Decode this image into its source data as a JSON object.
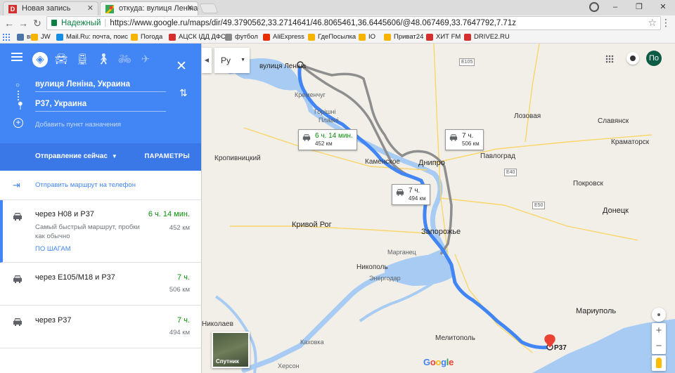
{
  "browser": {
    "tabs": [
      {
        "title": "Новая запись",
        "favicon_color": "#d32f2f",
        "favicon_letter": "D"
      },
      {
        "title": "откуда: вулиця Леніна, У",
        "favicon_color": "#34a853"
      }
    ],
    "window_buttons": [
      "–",
      "❐",
      "✕"
    ],
    "address": {
      "secure_label": "Надежный",
      "url": "https://www.google.ru/maps/dir/49.3790562,33.2714641/46.8065461,36.6445606/@48.067469,33.7647792,7.71z"
    },
    "bookmarks": [
      {
        "label": "вк",
        "color": "#4a76a8"
      },
      {
        "label": "JW",
        "color": "#f4b400"
      },
      {
        "label": "Mail.Ru: почта, поис",
        "color": "#168de2"
      },
      {
        "label": "Погода",
        "color": "#f4b400"
      },
      {
        "label": "АЦСК ІДД ДФС",
        "color": "#d32f2f"
      },
      {
        "label": "футбол",
        "color": "#888888"
      },
      {
        "label": "AliExpress",
        "color": "#e62e04"
      },
      {
        "label": "ГдеПосылка",
        "color": "#f4b400"
      },
      {
        "label": "IO",
        "color": "#f4b400"
      },
      {
        "label": "Приват24",
        "color": "#f4b400"
      },
      {
        "label": "ХИТ FM",
        "color": "#d32f2f"
      },
      {
        "label": "DRIVE2.RU",
        "color": "#d32f2f"
      }
    ]
  },
  "directions": {
    "modes": [
      "menu",
      "best",
      "car",
      "transit",
      "walk",
      "bike",
      "flight"
    ],
    "origin": "вулиця Леніна, Украина",
    "destination": "Р37, Украина",
    "add_destination": "Добавить пункт назначения",
    "depart": "Отправление сейчас",
    "params": "ПАРАМЕТРЫ",
    "send_to_phone": "Отправить маршрут на телефон",
    "routes": [
      {
        "via": "через Н08 и Р37",
        "time": "6 ч. 14 мин.",
        "distance": "452 км",
        "note": "Самый быстрый маршрут, пробки как обычно",
        "steps": "ПО ШАГАМ",
        "selected": true
      },
      {
        "via": "через E105/M18 и Р37",
        "time": "7 ч.",
        "distance": "506 км",
        "selected": false
      },
      {
        "via": "через Р37",
        "time": "7 ч.",
        "distance": "494 км",
        "selected": false
      }
    ]
  },
  "map": {
    "lang": "Ру",
    "avatar": "По",
    "satellite": "Спутник",
    "google": "Google",
    "origin_label": "вулиця Леніна",
    "dest_label": "Р37",
    "callouts": [
      {
        "time": "6 ч. 14 мин.",
        "distance": "452 км",
        "fastest": true
      },
      {
        "time": "7 ч.",
        "distance": "506 км",
        "fastest": false
      },
      {
        "time": "7 ч.",
        "distance": "494 км",
        "fastest": false
      }
    ],
    "places": [
      {
        "name": "Кременчуг",
        "kind": "small"
      },
      {
        "name": "Горішні",
        "kind": "small"
      },
      {
        "name": "Плавні",
        "kind": "small"
      },
      {
        "name": "Каменское",
        "kind": "city"
      },
      {
        "name": "Днипро",
        "kind": "big"
      },
      {
        "name": "Павлоград",
        "kind": "city"
      },
      {
        "name": "Лозовая",
        "kind": "city"
      },
      {
        "name": "Славянск",
        "kind": "city"
      },
      {
        "name": "Краматорск",
        "kind": "city"
      },
      {
        "name": "Покровск",
        "kind": "city"
      },
      {
        "name": "Донецк",
        "kind": "big"
      },
      {
        "name": "Кропивницкий",
        "kind": "city"
      },
      {
        "name": "Кривой Рог",
        "kind": "big"
      },
      {
        "name": "Запорожье",
        "kind": "big"
      },
      {
        "name": "Марганец",
        "kind": "small"
      },
      {
        "name": "Никополь",
        "kind": "city"
      },
      {
        "name": "Энергодар",
        "kind": "small"
      },
      {
        "name": "Мариуполь",
        "kind": "big"
      },
      {
        "name": "Мелитополь",
        "kind": "city"
      },
      {
        "name": "Каховка",
        "kind": "small"
      },
      {
        "name": "Херсон",
        "kind": "small"
      },
      {
        "name": "Николаев",
        "kind": "city"
      }
    ],
    "road_badges": [
      "E105",
      "E40",
      "E50"
    ]
  }
}
